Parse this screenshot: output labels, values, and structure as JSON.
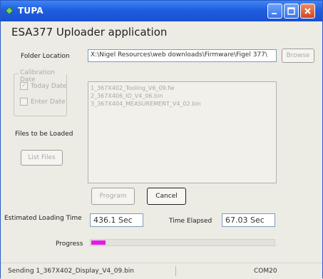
{
  "window": {
    "title": "TUPA"
  },
  "app": {
    "title": "ESA377 Uploader application"
  },
  "folder": {
    "label": "Folder Location",
    "value": "X:\\Nigel Resources\\web downloads\\Firmware\\Figel 377\\",
    "browse_label": "Browse"
  },
  "calibration": {
    "title": "Calibration Date",
    "options": [
      {
        "label": "Today Date",
        "checked": true
      },
      {
        "label": "Enter Date",
        "checked": false
      }
    ]
  },
  "files": {
    "label": "Files to be Loaded",
    "list_files_label": "List Files",
    "items": [
      "1_367X402_Tooling_V6_09.fw",
      "2_367X406_IO_V4_06.bin",
      "3_367X404_MEASUREMENT_V4_02.bin"
    ]
  },
  "actions": {
    "program_label": "Program",
    "cancel_label": "Cancel"
  },
  "timing": {
    "estimated_label": "Estimated Loading Time",
    "estimated_value": "436.1 Sec",
    "elapsed_label": "Time Elapsed",
    "elapsed_value": "67.03 Sec"
  },
  "progress": {
    "label": "Progress",
    "value_fraction": 0.08,
    "color": "#e21be8"
  },
  "status": {
    "message": "Sending 1_367X402_Display_V4_09.bin",
    "port": "COM20"
  },
  "colors": {
    "title_bar": "#2a63df",
    "close_button": "#d3471f",
    "window_bg": "#ecebe4"
  }
}
